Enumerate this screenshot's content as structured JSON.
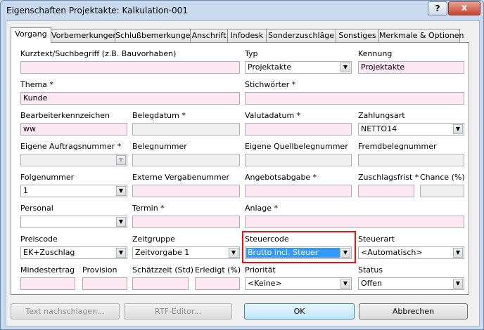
{
  "window": {
    "title": "Eigenschaften Projektakte: Kalkulation-001",
    "help_glyph": "?",
    "close_glyph": "x"
  },
  "tabs": [
    "Vorgang",
    "Vorbemerkungen",
    "Schlußbemerkungen",
    "Anschrift",
    "Infodesk",
    "Sonderzuschläge",
    "Sonstiges",
    "Merkmale & Optionen"
  ],
  "fields": {
    "kurztext": {
      "label": "Kurztext/Suchbegriff (z.B. Bauvorhaben)",
      "value": ""
    },
    "typ": {
      "label": "Typ",
      "value": "Projektakte"
    },
    "kennung": {
      "label": "Kennung",
      "value": "Projektakte"
    },
    "thema": {
      "label": "Thema *",
      "value": "Kunde"
    },
    "stichwoerter": {
      "label": "Stichwörter *",
      "value": ""
    },
    "bearbeiter": {
      "label": "Bearbeiterkennzeichen",
      "value": "ww"
    },
    "belegdatum": {
      "label": "Belegdatum *",
      "value": ""
    },
    "valutadatum": {
      "label": "Valutadatum *",
      "value": ""
    },
    "zahlungsart": {
      "label": "Zahlungsart",
      "value": "NETTO14"
    },
    "eigene_auftragsnr": {
      "label": "Eigene Auftragsnummer *",
      "value": ""
    },
    "belegnummer": {
      "label": "Belegnummer",
      "value": ""
    },
    "eigene_quellbelegnr": {
      "label": "Eigene Quellbelegnummer",
      "value": ""
    },
    "fremdbelegnr": {
      "label": "Fremdbelegnummer",
      "value": ""
    },
    "folgenummer": {
      "label": "Folgenummer",
      "value": "1"
    },
    "externe_vergabenr": {
      "label": "Externe Vergabenummer",
      "value": ""
    },
    "angebotsabgabe": {
      "label": "Angebotsabgabe *",
      "value": ""
    },
    "zuschlagsfrist": {
      "label": "Zuschlagsfrist *",
      "value": ""
    },
    "chance": {
      "label": "Chance (%)",
      "value": ""
    },
    "personal": {
      "label": "Personal",
      "value": ""
    },
    "termin": {
      "label": "Termin *",
      "value": ""
    },
    "anlage": {
      "label": "Anlage *",
      "value": ""
    },
    "preiscode": {
      "label": "Preiscode",
      "value": "EK+Zuschlag"
    },
    "zeitgruppe": {
      "label": "Zeitgruppe",
      "value": "Zeitvorgabe 1"
    },
    "steuercode": {
      "label": "Steuercode",
      "value": "Brutto incl. Steuer"
    },
    "steuerart": {
      "label": "Steuerart",
      "value": "<Automatisch>"
    },
    "mindestertrag": {
      "label": "Mindestertrag",
      "value": ""
    },
    "provision": {
      "label": "Provision",
      "value": ""
    },
    "schaetzzeit": {
      "label": "Schätzzeit (Std)",
      "value": ""
    },
    "erledigt": {
      "label": "Erledigt (%)",
      "value": ""
    },
    "prioritaet": {
      "label": "Priorität",
      "value": "<Keine>"
    },
    "status": {
      "label": "Status",
      "value": "Offen"
    }
  },
  "buttons": {
    "text_nachschlagen": "Text nachschlagen...",
    "rtf_editor": "RTF-Editor...",
    "ok": "OK",
    "abbrechen": "Abbrechen"
  },
  "dropdown_glyph": "▼"
}
